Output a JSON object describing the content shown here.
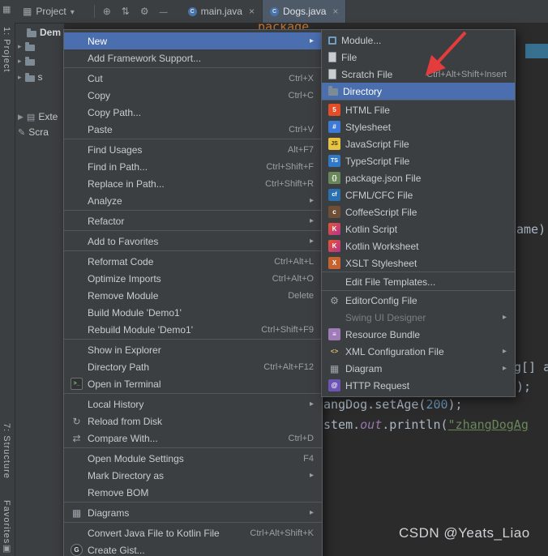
{
  "titlebar": {
    "project_label": "Project",
    "icons": [
      "window-grid-icon",
      "globe-icon",
      "sync-icon",
      "gear-icon",
      "minimize-icon"
    ],
    "tabs": [
      {
        "name": "tab-main-java",
        "label": "main.java",
        "icon": "class-icon",
        "selected": false
      },
      {
        "name": "tab-dogs-java",
        "label": "Dogs.java",
        "icon": "class-icon",
        "selected": true
      }
    ]
  },
  "left_stripe": {
    "top_label": "1: Project",
    "structure_label": "7: Structure",
    "favorites_label": "Favorites"
  },
  "project_panel": {
    "rows": [
      {
        "name": "project-root-row",
        "label": "Dem",
        "icon": "folder-icon"
      },
      {
        "name": "tree-row-1",
        "chevron": "▸",
        "icon": "folder-icon",
        "label": ""
      },
      {
        "name": "tree-row-2",
        "chevron": "▸",
        "icon": "folder-icon",
        "label": ""
      },
      {
        "name": "tree-row-3",
        "chevron": "▸",
        "icon": "folder-icon",
        "label": "s"
      },
      {
        "name": "tree-row-external-libraries",
        "chevron": "▶",
        "icon": "library-icon",
        "label": "Exte"
      },
      {
        "name": "tree-row-scratches",
        "chevron": "",
        "icon": "scratch-icon",
        "label": "Scra"
      }
    ]
  },
  "context_menu": {
    "items": [
      {
        "name": "menu-item-new",
        "label": "New",
        "arrow": true,
        "selected": true
      },
      {
        "name": "menu-item-add-framework-support",
        "label": "Add Framework Support..."
      },
      {
        "type": "separator"
      },
      {
        "name": "menu-item-cut",
        "label": "Cut",
        "shortcut": "Ctrl+X"
      },
      {
        "name": "menu-item-copy",
        "label": "Copy",
        "shortcut": "Ctrl+C"
      },
      {
        "name": "menu-item-copy-path",
        "label": "Copy Path..."
      },
      {
        "name": "menu-item-paste",
        "label": "Paste",
        "shortcut": "Ctrl+V"
      },
      {
        "type": "separator"
      },
      {
        "name": "menu-item-find-usages",
        "label": "Find Usages",
        "shortcut": "Alt+F7"
      },
      {
        "name": "menu-item-find-in-path",
        "label": "Find in Path...",
        "shortcut": "Ctrl+Shift+F"
      },
      {
        "name": "menu-item-replace-in-path",
        "label": "Replace in Path...",
        "shortcut": "Ctrl+Shift+R"
      },
      {
        "name": "menu-item-analyze",
        "label": "Analyze",
        "arrow": true
      },
      {
        "type": "separator"
      },
      {
        "name": "menu-item-refactor",
        "label": "Refactor",
        "arrow": true
      },
      {
        "type": "separator"
      },
      {
        "name": "menu-item-add-to-favorites",
        "label": "Add to Favorites",
        "arrow": true
      },
      {
        "type": "separator"
      },
      {
        "name": "menu-item-reformat-code",
        "label": "Reformat Code",
        "shortcut": "Ctrl+Alt+L"
      },
      {
        "name": "menu-item-optimize-imports",
        "label": "Optimize Imports",
        "shortcut": "Ctrl+Alt+O"
      },
      {
        "name": "menu-item-remove-module",
        "label": "Remove Module",
        "shortcut": "Delete"
      },
      {
        "name": "menu-item-build-module",
        "label": "Build Module 'Demo1'"
      },
      {
        "name": "menu-item-rebuild-module",
        "label": "Rebuild Module 'Demo1'",
        "shortcut": "Ctrl+Shift+F9"
      },
      {
        "type": "separator"
      },
      {
        "name": "menu-item-show-in-explorer",
        "label": "Show in Explorer"
      },
      {
        "name": "menu-item-directory-path",
        "label": "Directory Path",
        "shortcut": "Ctrl+Alt+F12"
      },
      {
        "name": "menu-item-open-in-terminal",
        "label": "Open in Terminal",
        "icon": "terminal-icon"
      },
      {
        "type": "separator"
      },
      {
        "name": "menu-item-local-history",
        "label": "Local History",
        "arrow": true
      },
      {
        "name": "menu-item-reload-from-disk",
        "label": "Reload from Disk",
        "icon": "refresh-icon"
      },
      {
        "name": "menu-item-compare-with",
        "label": "Compare With...",
        "shortcut": "Ctrl+D",
        "icon": "compare-icon"
      },
      {
        "type": "separator"
      },
      {
        "name": "menu-item-open-module-settings",
        "label": "Open Module Settings",
        "shortcut": "F4"
      },
      {
        "name": "menu-item-mark-directory-as",
        "label": "Mark Directory as",
        "arrow": true
      },
      {
        "name": "menu-item-remove-bom",
        "label": "Remove BOM"
      },
      {
        "type": "separator"
      },
      {
        "name": "menu-item-diagrams",
        "label": "Diagrams",
        "arrow": true,
        "icon": "diagram-icon"
      },
      {
        "type": "separator"
      },
      {
        "name": "menu-item-convert-java-to-kotlin",
        "label": "Convert Java File to Kotlin File",
        "shortcut": "Ctrl+Alt+Shift+K"
      },
      {
        "name": "menu-item-create-gist",
        "label": "Create Gist...",
        "icon": "gist-icon"
      }
    ]
  },
  "new_submenu": {
    "items": [
      {
        "name": "submenu-item-module",
        "label": "Module...",
        "icon": "module-icon"
      },
      {
        "name": "submenu-item-file",
        "label": "File",
        "icon": "file-icon"
      },
      {
        "name": "submenu-item-scratch-file",
        "label": "Scratch File",
        "shortcut": "Ctrl+Alt+Shift+Insert",
        "icon": "scratch-file-icon"
      },
      {
        "name": "submenu-item-directory",
        "label": "Directory",
        "icon": "folder-icon",
        "selected": true
      },
      {
        "type": "separator"
      },
      {
        "name": "submenu-item-html-file",
        "label": "HTML File",
        "icon": "html-icon"
      },
      {
        "name": "submenu-item-stylesheet",
        "label": "Stylesheet",
        "icon": "stylesheet-icon"
      },
      {
        "name": "submenu-item-javascript-file",
        "label": "JavaScript File",
        "icon": "js-icon"
      },
      {
        "name": "submenu-item-typescript-file",
        "label": "TypeScript File",
        "icon": "ts-icon"
      },
      {
        "name": "submenu-item-package-json",
        "label": "package.json File",
        "icon": "package-json-icon"
      },
      {
        "name": "submenu-item-cfml-cfc",
        "label": "CFML/CFC File",
        "icon": "cfml-icon"
      },
      {
        "name": "submenu-item-coffeescript",
        "label": "CoffeeScript File",
        "icon": "coffeescript-icon"
      },
      {
        "name": "submenu-item-kotlin-script",
        "label": "Kotlin Script",
        "icon": "kotlin-icon"
      },
      {
        "name": "submenu-item-kotlin-worksheet",
        "label": "Kotlin Worksheet",
        "icon": "kotlin-icon"
      },
      {
        "name": "submenu-item-xslt-stylesheet",
        "label": "XSLT Stylesheet",
        "icon": "xslt-icon"
      },
      {
        "type": "separator"
      },
      {
        "name": "submenu-item-edit-file-templates",
        "label": "Edit File Templates..."
      },
      {
        "type": "separator"
      },
      {
        "name": "submenu-item-editorconfig-file",
        "label": "EditorConfig File",
        "icon": "editorconfig-icon"
      },
      {
        "name": "submenu-item-swing-ui-designer",
        "label": "Swing UI Designer",
        "arrow": true,
        "enabled": false
      },
      {
        "name": "submenu-item-resource-bundle",
        "label": "Resource Bundle",
        "icon": "resource-bundle-icon"
      },
      {
        "name": "submenu-item-xml-configuration-file",
        "label": "XML Configuration File",
        "icon": "xml-icon",
        "arrow": true
      },
      {
        "name": "submenu-item-diagram",
        "label": "Diagram",
        "arrow": true,
        "icon": "diagram-icon"
      },
      {
        "name": "submenu-item-http-request",
        "label": "HTTP Request",
        "icon": "http-request-icon"
      }
    ]
  },
  "editor": {
    "lines": [
      {
        "name": "code-line-package",
        "segments": [
          {
            "text": "package",
            "color": "keyword"
          }
        ]
      },
      {
        "name": "code-frag-name-paren",
        "segments": [
          {
            "text": "ame)",
            "color": "plain"
          }
        ]
      },
      {
        "name": "code-frag-args",
        "segments": [
          {
            "text": "g[] a",
            "color": "plain"
          }
        ]
      },
      {
        "name": "code-frag-close-paren",
        "segments": [
          {
            "text": ");",
            "color": "plain"
          }
        ]
      },
      {
        "name": "code-line-setage",
        "segments": [
          {
            "text": "angDog.setAge(",
            "color": "plain"
          },
          {
            "text": "200",
            "color": "number"
          },
          {
            "text": ");",
            "color": "plain"
          }
        ]
      },
      {
        "name": "code-line-println",
        "segments": [
          {
            "text": "stem.",
            "color": "plain"
          },
          {
            "text": "out",
            "color": "field"
          },
          {
            "text": ".println(",
            "color": "plain"
          },
          {
            "text": "\"zhangDogAg",
            "color": "string-typo"
          }
        ]
      }
    ]
  },
  "watermark": "CSDN @Yeats_Liao",
  "colors": {
    "selection": "#4b6eaf",
    "menu_background": "#3c3f41",
    "editor_background": "#2b2b2b",
    "annotation_arrow": "#e43c3c"
  }
}
